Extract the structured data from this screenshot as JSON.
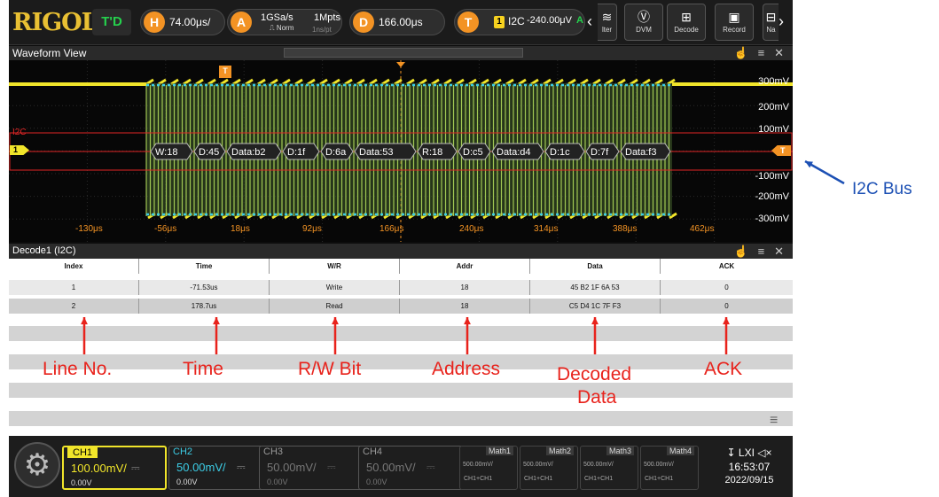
{
  "topbar": {
    "logo": "RIGOL",
    "run_mode": "T'D",
    "horizontal": {
      "badge": "H",
      "value": "74.00μs/"
    },
    "acquisition": {
      "badge": "A",
      "rate": "1GSa/s",
      "mode": "Norm",
      "memory": "1Mpts",
      "resolution": "1ns/pt"
    },
    "delay": {
      "badge": "D",
      "value": "166.00μs"
    },
    "trigger": {
      "badge": "T",
      "channel": "1",
      "type": "I2C",
      "level": "-240.00μV",
      "mode": "A"
    },
    "buttons": [
      {
        "label": "lter",
        "icon": "filter-icon"
      },
      {
        "label": "DVM",
        "icon": "dvm-icon"
      },
      {
        "label": "Decode",
        "icon": "decode-icon"
      },
      {
        "label": "Record",
        "icon": "record-icon"
      },
      {
        "label": "Na",
        "icon": "navigate-icon"
      }
    ]
  },
  "waveform": {
    "title": "Waveform View",
    "y_labels": [
      "300mV",
      "200mV",
      "100mV",
      "-100mV",
      "-200mV",
      "-300mV"
    ],
    "x_labels": [
      "-130μs",
      "-56μs",
      "18μs",
      "92μs",
      "166μs",
      "240μs",
      "314μs",
      "388μs",
      "462μs"
    ],
    "bus_label": "I2C",
    "channel_marker": "1",
    "trigger_marker": "T",
    "decode_labels": [
      "W:18",
      "D:45",
      "Data:b2",
      "D:1f",
      "D:6a",
      "Data:53",
      "R:18",
      "D:c5",
      "Data:d4",
      "D:1c",
      "D:7f",
      "Data:f3"
    ],
    "colors": {
      "ch1": "#f1e52a",
      "ch2": "#3ccde6",
      "decode": "#e02626",
      "accent": "#f39324"
    }
  },
  "decode_table": {
    "title": "Decode1 (I2C)",
    "columns": [
      "Index",
      "Time",
      "W/R",
      "Addr",
      "Data",
      "ACK"
    ],
    "rows": [
      [
        "1",
        "-71.53us",
        "Write",
        "18",
        "45 B2 1F 6A 53",
        "0"
      ],
      [
        "2",
        "178.7us",
        "Read",
        "18",
        "C5 D4 1C 7F F3",
        "0"
      ]
    ]
  },
  "channels": [
    {
      "name": "CH1",
      "scale": "100.00mV/",
      "offset": "0.00V",
      "color": "#f1e52a",
      "active": true
    },
    {
      "name": "CH2",
      "scale": "50.00mV/",
      "offset": "0.00V",
      "color": "#3ccde6",
      "active": true
    },
    {
      "name": "CH3",
      "scale": "50.00mV/",
      "offset": "0.00V",
      "color": "#888888",
      "active": false
    },
    {
      "name": "CH4",
      "scale": "50.00mV/",
      "offset": "0.00V",
      "color": "#888888",
      "active": false
    }
  ],
  "math": [
    {
      "name": "Math1",
      "scale": "500.00mV/",
      "expr": "CH1+CH1"
    },
    {
      "name": "Math2",
      "scale": "500.00mV/",
      "expr": "CH1+CH1"
    },
    {
      "name": "Math3",
      "scale": "500.00mV/",
      "expr": "CH1+CH1"
    },
    {
      "name": "Math4",
      "scale": "500.00mV/",
      "expr": "CH1+CH1"
    }
  ],
  "status": {
    "icons": "↧ LXI ◁×",
    "time": "16:53:07",
    "date": "2022/09/15"
  },
  "annotations": {
    "bus": "I2C Bus",
    "labels": [
      "Line No.",
      "Time",
      "R/W Bit",
      "Address",
      "Decoded",
      "Data",
      "ACK"
    ]
  }
}
